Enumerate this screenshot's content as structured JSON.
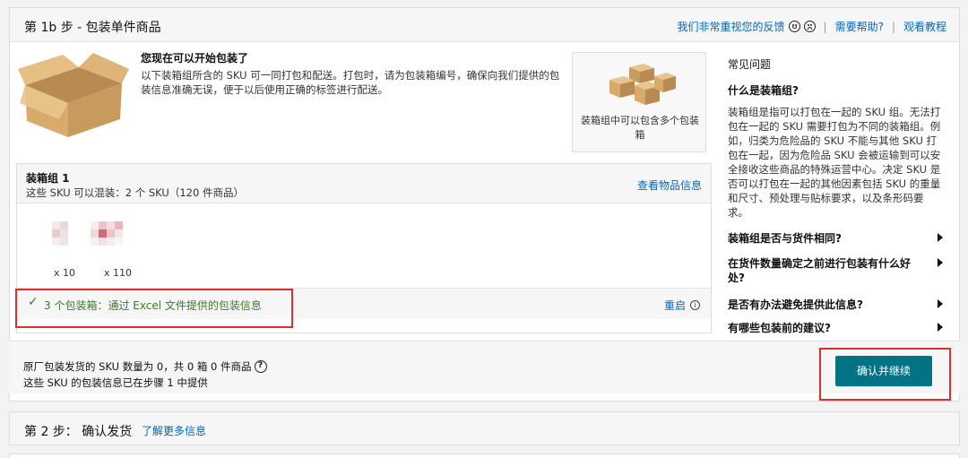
{
  "header": {
    "title": "第 1b 步 - 包装单件商品",
    "feedback_label": "我们非常重视您的反馈",
    "help_label": "需要帮助?",
    "tutorial_label": "观看教程",
    "separator": "|"
  },
  "intro": {
    "heading": "您现在可以开始包装了",
    "text": "以下装箱组所含的 SKU 可一同打包和配送。打包时，请为包装箱编号，确保向我们提供的包装信息准确无误，便于以后使用正确的标签进行配送。",
    "multi_box_caption": "装箱组中可以包含多个包装箱"
  },
  "group": {
    "title": "装箱组 1",
    "subtitle": "这些 SKU 可以混装：2 个 SKU（120 件商品）",
    "view_link": "查看物品信息",
    "items": [
      {
        "qty": "x 10"
      },
      {
        "qty": "x 110"
      }
    ],
    "status_check": "✓",
    "status_text": "3 个包装箱：通过 Excel 文件提供的包装信息",
    "restart_label": "重启",
    "info_symbol": "i"
  },
  "faq": {
    "title": "常见问题",
    "question": "什么是装箱组?",
    "answer": "装箱组是指可以打包在一起的 SKU 组。无法打包在一起的 SKU 需要打包为不同的装箱组。例如，归类为危险品的 SKU 不能与其他 SKU 打包在一起，因为危险品 SKU 会被运输到可以安全接收这些商品的特殊运营中心。决定 SKU 是否可以打包在一起的其他因素包括 SKU 的重量和尺寸、预处理与贴标要求，以及条形码要求。",
    "items": [
      "装箱组是否与货件相同?",
      "在货件数量确定之前进行包装有什么好处?",
      "是否有办法避免提供此信息?",
      "有哪些包装前的建议?"
    ]
  },
  "footer": {
    "line1": "原厂包装发货的 SKU 数量为 0，共 0 箱 0 件商品",
    "help_symbol": "?",
    "line2": "这些 SKU 的包装信息已在步骤 1 中提供",
    "confirm_label": "确认并继续"
  },
  "step2": {
    "title": "第 2 步： 确认发货",
    "link": "了解更多信息"
  },
  "colors": {
    "link": "#0066c0",
    "primary_button": "#007485",
    "success": "#3b7a2a",
    "highlight": "#e02d2d"
  }
}
